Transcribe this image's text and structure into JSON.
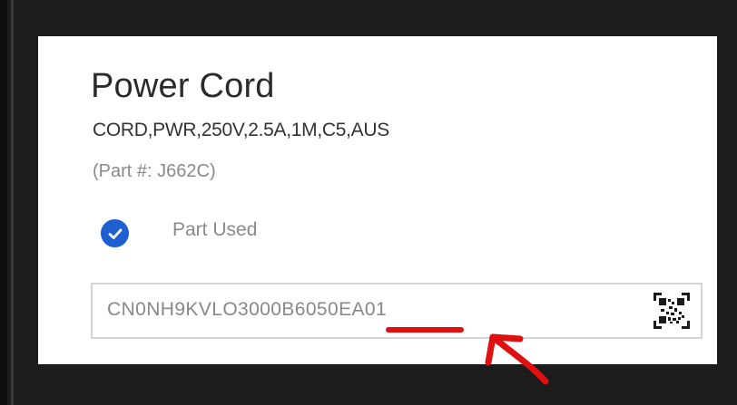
{
  "item": {
    "title": "Power Cord",
    "description": "CORD,PWR,250V,2.5A,1M,C5,AUS",
    "part_number": "(Part #: J662C)"
  },
  "status": {
    "checked": true,
    "label": "Part Used"
  },
  "serial_field": {
    "value": "CN0NH9KVLO3000B6050EA01"
  },
  "icons": {
    "check": "check-circle-icon",
    "scan": "qr-code-icon"
  },
  "colors": {
    "accent": "#1f5fd1",
    "annotation": "#e01010",
    "background": "#1c1c1c",
    "card": "#ffffff"
  }
}
